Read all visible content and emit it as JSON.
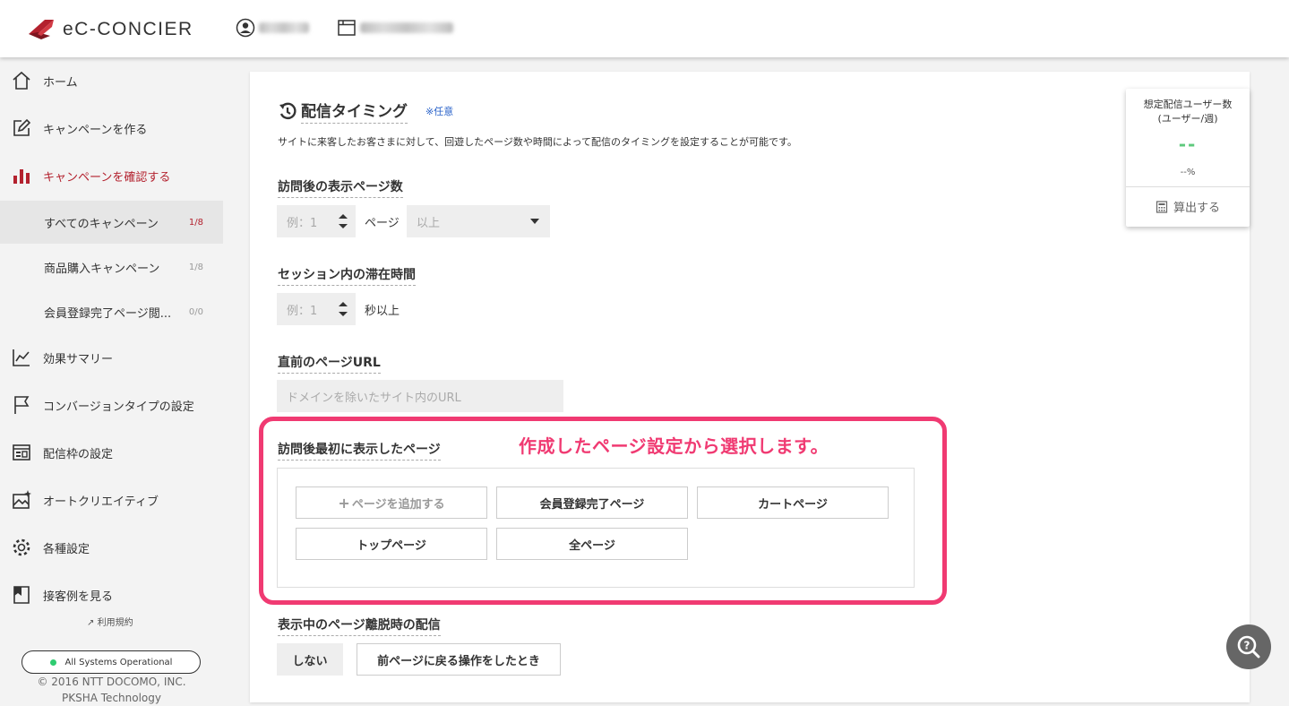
{
  "header": {
    "logo_text": "eC-CONCIER"
  },
  "sidebar": {
    "items": [
      {
        "label": "ホーム"
      },
      {
        "label": "キャンペーンを作る"
      },
      {
        "label": "キャンペーンを確認する"
      },
      {
        "label": "効果サマリー"
      },
      {
        "label": "コンバージョンタイプの設定"
      },
      {
        "label": "配信枠の設定"
      },
      {
        "label": "オートクリエイティブ"
      },
      {
        "label": "各種設定"
      },
      {
        "label": "接客例を見る"
      }
    ],
    "sub_items": [
      {
        "label": "すべてのキャンペーン",
        "count": "1/8"
      },
      {
        "label": "商品購入キャンペーン",
        "count": "1/8"
      },
      {
        "label": "会員登録完了ページ閲...",
        "count": "0/0"
      }
    ],
    "terms_label": "利用規約",
    "status_label": "All Systems Operational",
    "copyright_1": "© 2016 NTT DOCOMO, INC.",
    "copyright_2": "PKSHA Technology",
    "colors": {
      "active": "#b3212e",
      "status_ok": "#2ecc71"
    }
  },
  "main": {
    "section_title": "配信タイミング",
    "optional_label": "※任意",
    "description": "サイトに来客したお客さまに対して、回遊したページ数や時間によって配信のタイミングを設定することが可能です。",
    "page_count": {
      "label": "訪問後の表示ページ数",
      "placeholder": "例：1",
      "unit": "ページ",
      "select_value": "以上"
    },
    "session_time": {
      "label": "セッション内の滞在時間",
      "placeholder": "例：1",
      "unit": "秒以上"
    },
    "prev_url": {
      "label": "直前のページURL",
      "placeholder": "ドメインを除いたサイト内のURL"
    },
    "first_page": {
      "label": "訪問後最初に表示したページ",
      "annotation": "作成したページ設定から選択します。",
      "add_label": "ページを追加する",
      "pages": [
        "会員登録完了ページ",
        "カートページ",
        "トップページ",
        "全ページ"
      ]
    },
    "leave": {
      "label": "表示中のページ離脱時の配信",
      "off_label": "しない",
      "back_label": "前ページに戻る操作をしたとき"
    },
    "colors": {
      "annotation": "#f03a72",
      "link": "#2962c9"
    }
  },
  "estimate": {
    "title_line1": "想定配信ユーザー数",
    "title_line2": "(ユーザー/週)",
    "value": "--",
    "percent": "--%",
    "calc_label": "算出する",
    "color": "#5ec97c"
  },
  "help_icon": "search-help-icon"
}
